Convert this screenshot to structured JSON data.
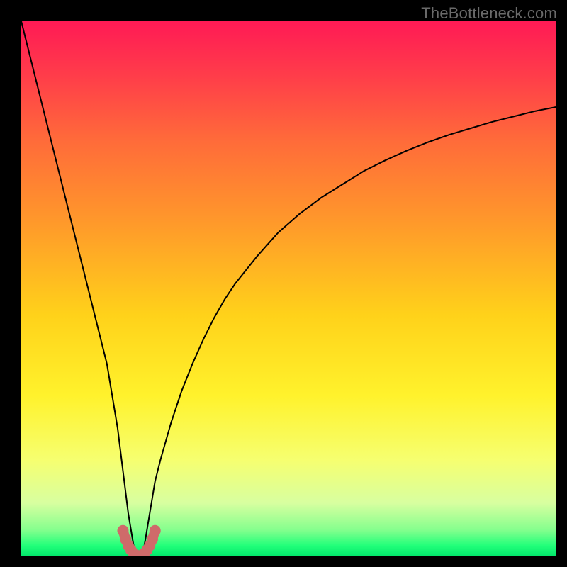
{
  "watermark": "TheBottleneck.com",
  "chart_data": {
    "type": "line",
    "title": "",
    "xlabel": "",
    "ylabel": "",
    "xlim": [
      0,
      100
    ],
    "ylim": [
      0,
      100
    ],
    "grid": false,
    "legend": false,
    "series": [
      {
        "name": "bottleneck-curve",
        "color": "#000000",
        "x": [
          0,
          2,
          4,
          6,
          8,
          10,
          12,
          14,
          16,
          18,
          19,
          20,
          21,
          22,
          23,
          24,
          25,
          26,
          28,
          30,
          32,
          34,
          36,
          38,
          40,
          44,
          48,
          52,
          56,
          60,
          64,
          68,
          72,
          76,
          80,
          84,
          88,
          92,
          96,
          100
        ],
        "values": [
          100,
          92,
          84,
          76,
          68,
          60,
          52,
          44,
          36,
          24,
          16,
          8,
          2,
          0,
          2,
          8,
          14,
          18,
          25,
          31,
          36,
          40.5,
          44.5,
          48,
          51,
          56,
          60.5,
          64,
          67,
          69.5,
          72,
          74,
          75.8,
          77.4,
          78.8,
          80,
          81.2,
          82.2,
          83.2,
          84
        ]
      },
      {
        "name": "optimal-highlight",
        "color": "#cf6a6a",
        "x": [
          19.0,
          19.5,
          20.0,
          20.5,
          21.0,
          21.5,
          22.0,
          22.5,
          23.0,
          23.5,
          24.0,
          24.5,
          25.0
        ],
        "values": [
          4.8,
          3.2,
          2.0,
          1.2,
          0.6,
          0.2,
          0.0,
          0.2,
          0.6,
          1.2,
          2.0,
          3.2,
          4.8
        ]
      }
    ],
    "background_gradient": {
      "type": "vertical",
      "stops": [
        {
          "offset": 0.0,
          "color": "#ff1a55"
        },
        {
          "offset": 0.1,
          "color": "#ff3c4a"
        },
        {
          "offset": 0.22,
          "color": "#ff6a3a"
        },
        {
          "offset": 0.38,
          "color": "#ff9a2a"
        },
        {
          "offset": 0.55,
          "color": "#ffd21a"
        },
        {
          "offset": 0.7,
          "color": "#fff22c"
        },
        {
          "offset": 0.82,
          "color": "#f6ff70"
        },
        {
          "offset": 0.9,
          "color": "#d8ffa0"
        },
        {
          "offset": 0.95,
          "color": "#86ff8e"
        },
        {
          "offset": 0.98,
          "color": "#22ff7a"
        },
        {
          "offset": 1.0,
          "color": "#00e66a"
        }
      ]
    }
  }
}
